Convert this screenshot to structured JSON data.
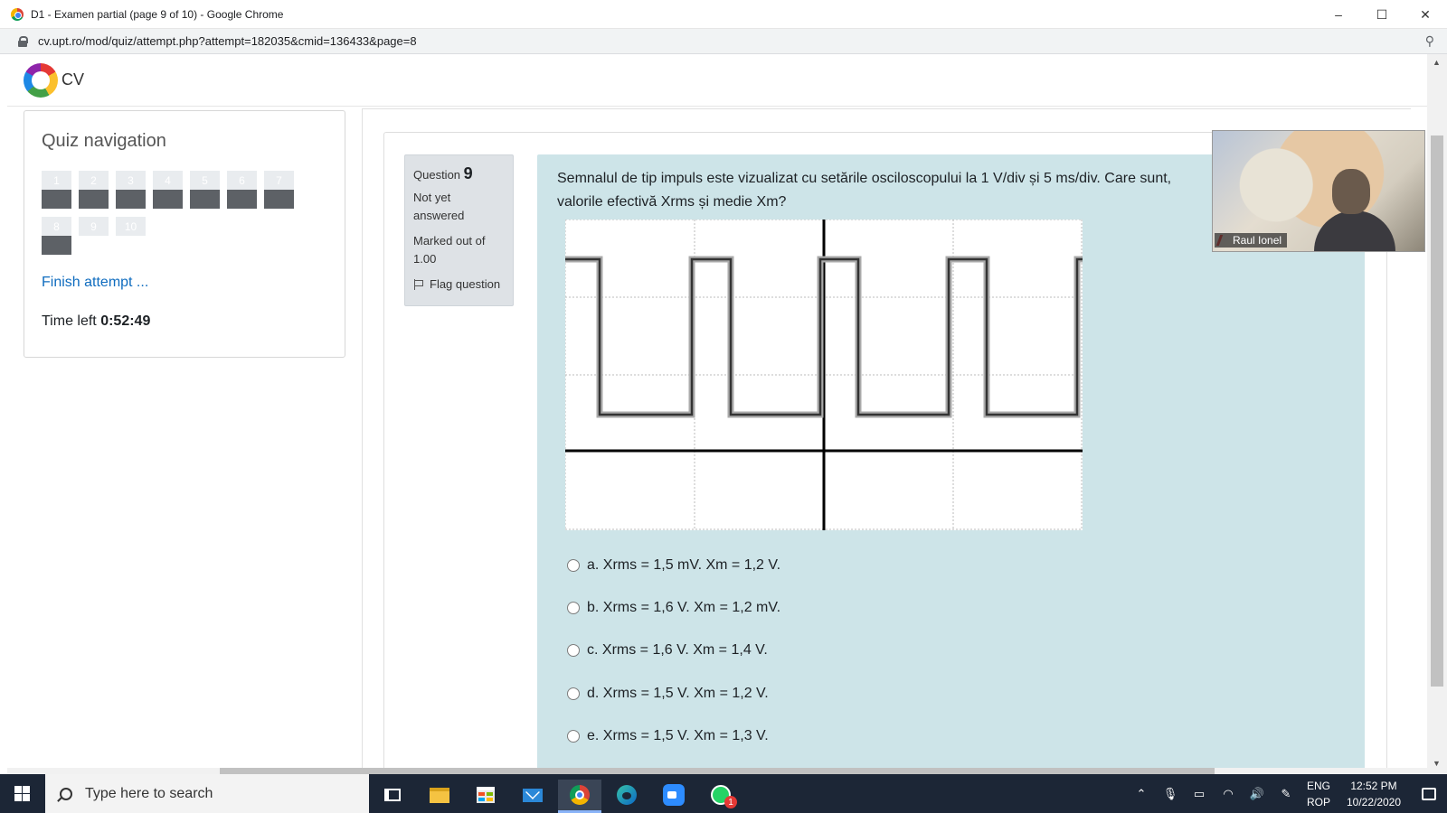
{
  "browser": {
    "window_title": "D1 - Examen partial (page 9 of 10) - Google Chrome",
    "url": "cv.upt.ro/mod/quiz/attempt.php?attempt=182035&cmid=136433&page=8",
    "controls": {
      "minimize": "–",
      "maximize": "☐",
      "close": "✕"
    }
  },
  "site": {
    "name": "CV"
  },
  "quiz_nav": {
    "title": "Quiz navigation",
    "questions": [
      {
        "label": "1",
        "state": "answered"
      },
      {
        "label": "2",
        "state": "answered"
      },
      {
        "label": "3",
        "state": "answered"
      },
      {
        "label": "4",
        "state": "answered"
      },
      {
        "label": "5",
        "state": "answered"
      },
      {
        "label": "6",
        "state": "answered"
      },
      {
        "label": "7",
        "state": "answered"
      },
      {
        "label": "8",
        "state": "answered"
      },
      {
        "label": "9",
        "state": "current"
      },
      {
        "label": "10",
        "state": "notyet"
      }
    ],
    "finish_label": "Finish attempt ...",
    "time_left_label": "Time left",
    "time_left_value": "0:52:49"
  },
  "question": {
    "number_label": "Question",
    "number": "9",
    "state": "Not yet answered",
    "grade": "Marked out of 1.00",
    "flag_label": "Flag question",
    "text": "Semnalul de tip impuls este vizualizat cu setările osciloscopului la 1 V/div și 5 ms/div. Care sunt, valorile efectivă Xrms și medie Xm?",
    "answers": [
      "a. Xrms = 1,5 mV. Xm = 1,2 V.",
      "b. Xrms = 1,6 V. Xm = 1,2 mV.",
      "c. Xrms = 1,6 V. Xm = 1,4 V.",
      "d. Xrms = 1,5 V. Xm = 1,2 V.",
      "e. Xrms = 1,5 V. Xm = 1,3 V."
    ]
  },
  "video": {
    "participant": "Raul Ionel"
  },
  "taskbar": {
    "search_placeholder": "Type here to search",
    "whatsapp_badge": "1",
    "lang_top": "ENG",
    "lang_bottom": "ROP",
    "time": "12:52 PM",
    "date": "10/22/2020"
  }
}
